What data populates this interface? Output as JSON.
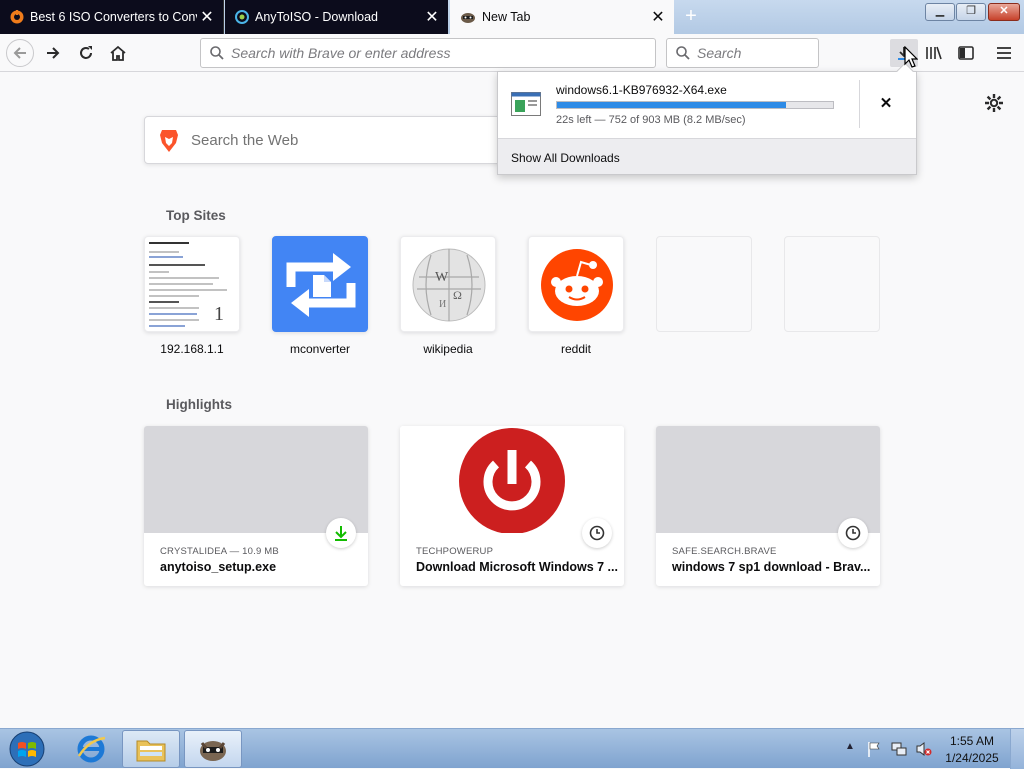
{
  "tabs": [
    {
      "title": "Best 6 ISO Converters to Conve",
      "active": false
    },
    {
      "title": "AnyToISO - Download",
      "active": false
    },
    {
      "title": "New Tab",
      "active": true
    }
  ],
  "navbar": {
    "address_placeholder": "Search with Brave or enter address",
    "search_placeholder": "Search"
  },
  "page": {
    "web_search_placeholder": "Search the Web",
    "top_sites_title": "Top Sites",
    "highlights_title": "Highlights",
    "top_sites": [
      {
        "label": "192.168.1.1",
        "pin": "1"
      },
      {
        "label": "mconverter"
      },
      {
        "label": "wikipedia"
      },
      {
        "label": "reddit"
      }
    ],
    "highlights": [
      {
        "source": "CRYSTALIDEA — 10.9 MB",
        "title": "anytoiso_setup.exe",
        "badge": "download-icon"
      },
      {
        "source": "TECHPOWERUP",
        "title": "Download Microsoft Windows 7 ...",
        "badge": "clock-icon"
      },
      {
        "source": "SAFE.SEARCH.BRAVE",
        "title": "windows 7 sp1 download - Brav...",
        "badge": "clock-icon"
      }
    ]
  },
  "downloads": {
    "filename": "windows6.1-KB976932-X64.exe",
    "progress_fraction": 0.83,
    "status": "22s left — 752 of 903 MB (8.2 MB/sec)",
    "show_all": "Show All Downloads"
  },
  "taskbar": {
    "time": "1:55 AM",
    "date": "1/24/2025"
  },
  "colors": {
    "tab_strip_dark": "#0c0c1c",
    "progress_blue": "#2e8be6",
    "mconverter_blue": "#4285f4",
    "reddit_orange": "#ff4500",
    "power_red": "#cc1f1f",
    "download_green": "#12bc00"
  }
}
